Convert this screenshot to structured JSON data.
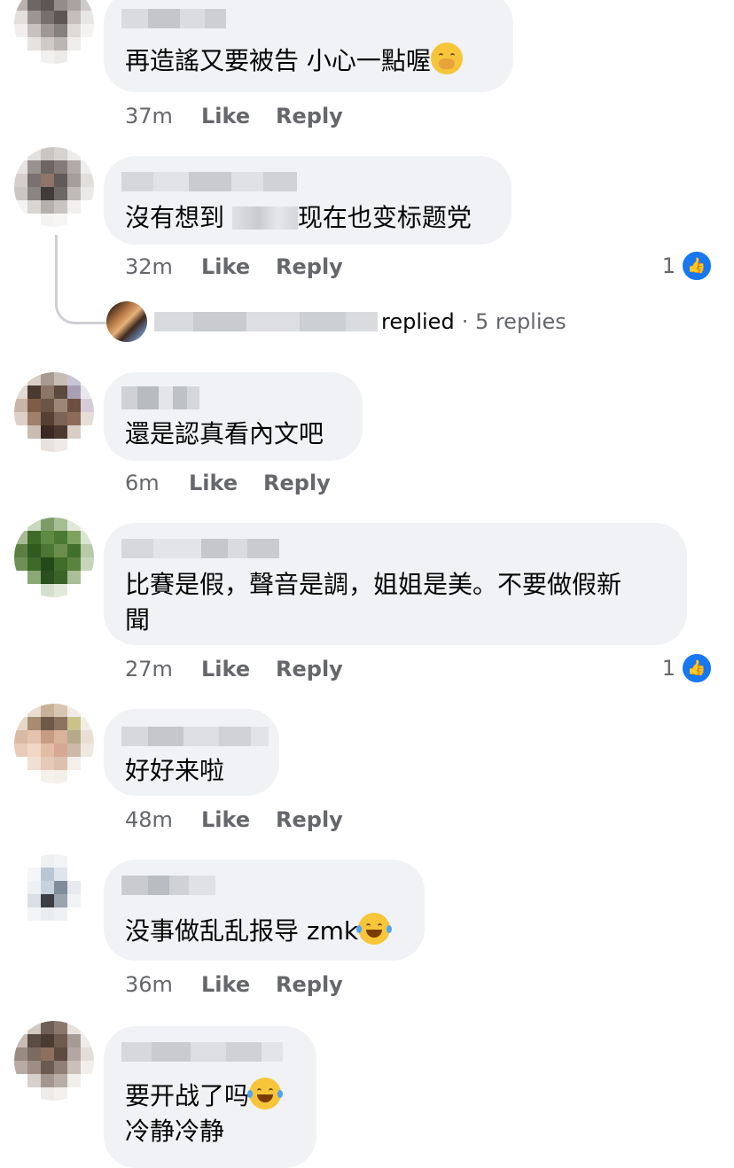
{
  "colors": {
    "bubble": "#f0f2f5",
    "meta_text": "#65676b",
    "like_blue": "#1877f2"
  },
  "comments": [
    {
      "text": "再造謠又要被告 小心一點喔",
      "emoji": "hand-over-mouth-emoji",
      "time": "37m",
      "like": "Like",
      "reply": "Reply"
    },
    {
      "text_before": "沒有想到",
      "text_after": "现在也变标题党",
      "time": "32m",
      "like": "Like",
      "reply": "Reply",
      "reactions": "1"
    },
    {
      "text": "還是認真看內文吧",
      "time": "6m",
      "like": "Like",
      "reply": "Reply"
    },
    {
      "line1": "比賽是假，聲音是調，姐姐是美。不要做假新",
      "line2": "聞",
      "time": "27m",
      "like": "Like",
      "reply": "Reply",
      "reactions": "1"
    },
    {
      "text": "好好来啦",
      "time": "48m",
      "like": "Like",
      "reply": "Reply"
    },
    {
      "text": "没事做乱乱报导 zmk",
      "emoji": "laughing-tears-emoji",
      "time": "36m",
      "like": "Like",
      "reply": "Reply"
    },
    {
      "line1": "要开战了吗",
      "line2": "冷静冷静",
      "emoji": "laughing-tears-emoji"
    }
  ],
  "thread_summary": {
    "replied": "replied",
    "count": "· 5 replies"
  }
}
